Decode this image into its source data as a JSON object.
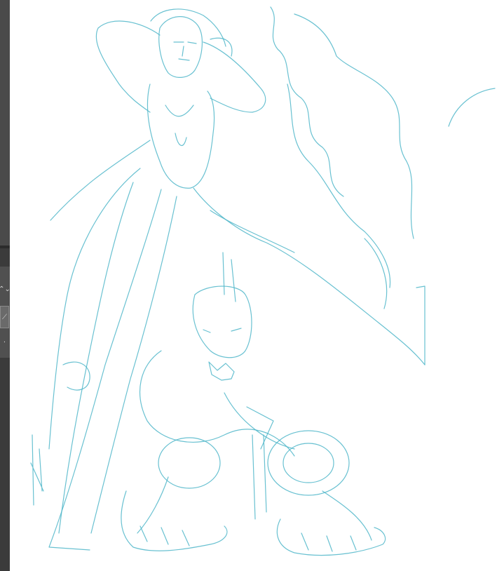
{
  "app": {
    "tools": [
      {
        "name": "stepper-icon",
        "glyph": "⌃⌄"
      },
      {
        "name": "pen-icon",
        "glyph": "⟋"
      },
      {
        "name": "dot-icon",
        "glyph": "·"
      }
    ]
  },
  "colors": {
    "sketch_line": "#4fb6c9",
    "sidebar_bg": "#3b3b3b",
    "canvas_bg": "#ffffff"
  }
}
